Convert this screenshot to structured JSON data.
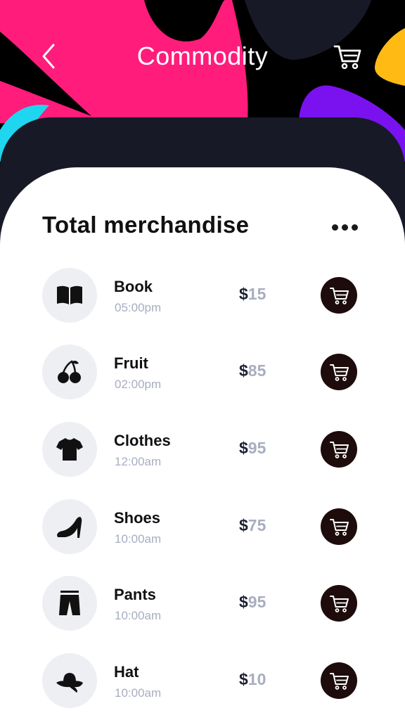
{
  "header": {
    "title": "Commodity",
    "back_icon": "chevron-left-icon",
    "cart_icon": "shopping-cart-icon"
  },
  "section": {
    "title": "Total merchandise",
    "more_icon": "more-dots-icon"
  },
  "items": [
    {
      "name": "Book",
      "time": "05:00pm",
      "currency": "$",
      "amount": "15",
      "icon": "book-icon"
    },
    {
      "name": "Fruit",
      "time": "02:00pm",
      "currency": "$",
      "amount": "85",
      "icon": "cherry-icon"
    },
    {
      "name": "Clothes",
      "time": "12:00am",
      "currency": "$",
      "amount": "95",
      "icon": "tshirt-icon"
    },
    {
      "name": "Shoes",
      "time": "10:00am",
      "currency": "$",
      "amount": "75",
      "icon": "high-heel-icon"
    },
    {
      "name": "Pants",
      "time": "10:00am",
      "currency": "$",
      "amount": "95",
      "icon": "pants-icon"
    },
    {
      "name": "Hat",
      "time": "10:00am",
      "currency": "$",
      "amount": "10",
      "icon": "hat-icon"
    }
  ],
  "colors": {
    "pink": "#ff1c7b",
    "navy": "#171a26",
    "yellow": "#ffbb14",
    "purple": "#7a12f0",
    "cyan": "#1fd6f0",
    "cart_button": "#1e0c0c",
    "price_muted": "#a8aec0"
  }
}
